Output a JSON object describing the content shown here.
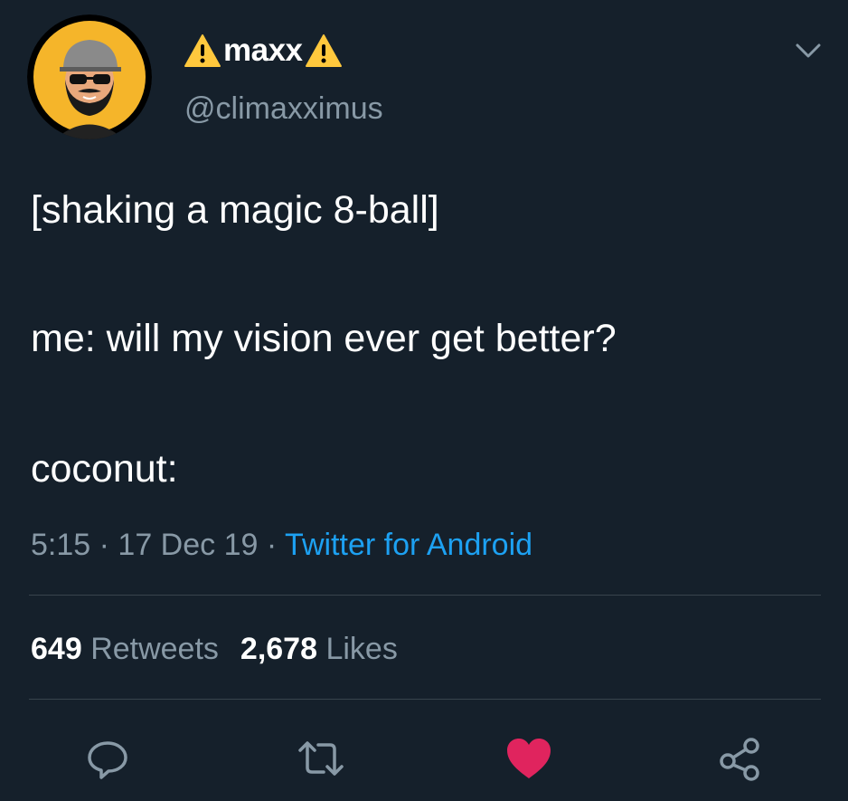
{
  "tweet": {
    "display_name": "maxx",
    "handle": "@climaxximus",
    "lines": [
      "[shaking a magic 8-ball]",
      "me: will my vision ever get better?",
      "coconut:"
    ],
    "time": "5:15",
    "date": "17 Dec 19",
    "separator": "·",
    "source": "Twitter for Android"
  },
  "stats": {
    "retweets_count": "649",
    "retweets_label": "Retweets",
    "likes_count": "2,678",
    "likes_label": "Likes"
  },
  "actions": [
    "reply-icon",
    "retweet-icon",
    "heart-icon",
    "share-icon"
  ],
  "icons": {
    "name_prefix": "warning-icon",
    "name_suffix": "warning-icon",
    "menu": "chevron-down-icon"
  },
  "colors": {
    "background": "#15202b",
    "text": "#ffffff",
    "secondary_text": "#8899a6",
    "link": "#1da1f2",
    "divider": "#38444d",
    "like_active": "#e0245e",
    "avatar_bg": "#f5b52a",
    "warning": "#ffc83d"
  }
}
